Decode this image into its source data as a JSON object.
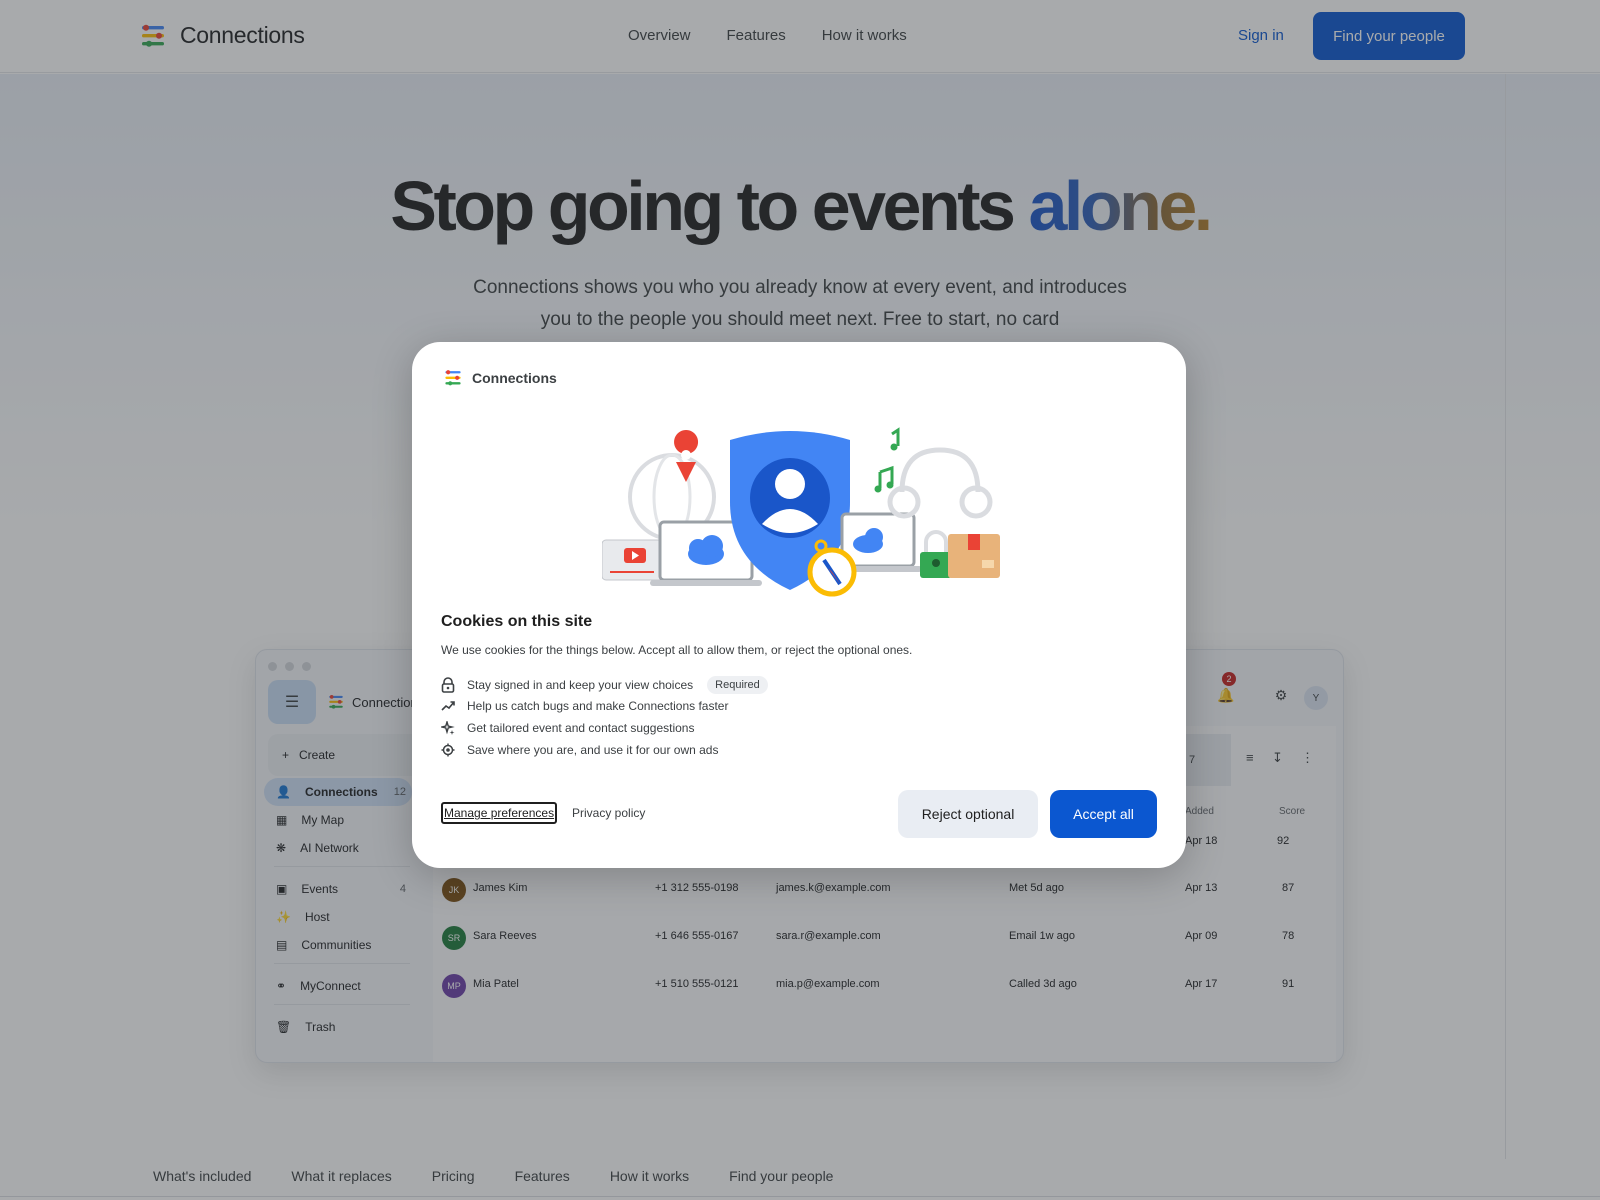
{
  "nav": {
    "brand": "Connections",
    "links": [
      "Overview",
      "Features",
      "How it works"
    ],
    "signin": "Sign in",
    "cta": "Find your people"
  },
  "hero": {
    "title_main": "Stop going to events ",
    "title_accent": "alone.",
    "subtitle": "Connections shows you who you already know at every event, and introduces you to the people you should meet next. Free to start, no card"
  },
  "app": {
    "brand": "Connection",
    "create": "Create",
    "sidebar": [
      {
        "label": "Connections",
        "count": "12",
        "icon": "person-icon"
      },
      {
        "label": "My Map",
        "count": "",
        "icon": "map-icon"
      },
      {
        "label": "AI Network",
        "count": "",
        "icon": "network-icon"
      },
      {
        "label": "Events",
        "count": "4",
        "icon": "calendar-icon"
      },
      {
        "label": "Host",
        "count": "",
        "icon": "party-icon"
      },
      {
        "label": "Communities",
        "count": "",
        "icon": "community-icon"
      },
      {
        "label": "MyConnect",
        "count": "",
        "icon": "link-icon"
      },
      {
        "label": "Trash",
        "count": "",
        "icon": "trash-icon"
      }
    ],
    "notifications": "2",
    "avatar": "Y",
    "filter_pill": "ll 7",
    "columns": {
      "added": "Added",
      "score": "Score"
    },
    "partial_row": {
      "added": "Apr 18",
      "score": "92"
    },
    "rows": [
      {
        "initials": "JK",
        "name": "James Kim",
        "phone": "+1 312 555-0198",
        "email": "james.k@example.com",
        "last": "Met 5d ago",
        "added": "Apr 13",
        "score": "87",
        "color": "#7a4e12"
      },
      {
        "initials": "SR",
        "name": "Sara Reeves",
        "phone": "+1 646 555-0167",
        "email": "sara.r@example.com",
        "last": "Email 1w ago",
        "added": "Apr 09",
        "score": "78",
        "color": "#1e7a3c"
      },
      {
        "initials": "MP",
        "name": "Mia Patel",
        "phone": "+1 510 555-0121",
        "email": "mia.p@example.com",
        "last": "Called 3d ago",
        "added": "Apr 17",
        "score": "91",
        "color": "#6b3fa8"
      }
    ]
  },
  "modal": {
    "brand": "Connections",
    "title": "Cookies on this site",
    "description": "We use cookies for the things below. Accept all to allow them, or reject the optional ones.",
    "purposes": [
      {
        "text": "Stay signed in and keep your view choices",
        "badge": "Required",
        "icon": "lock-icon"
      },
      {
        "text": "Help us catch bugs and make Connections faster",
        "icon": "trend-icon"
      },
      {
        "text": "Get tailored event and contact suggestions",
        "icon": "sparkle-icon"
      },
      {
        "text": "Save where you are, and use it for our own ads",
        "icon": "location-target-icon"
      }
    ],
    "manage": "Manage preferences",
    "privacy": "Privacy policy",
    "reject": "Reject optional",
    "accept": "Accept all"
  },
  "bottom_tabs": [
    "What's included",
    "What it replaces",
    "Pricing",
    "Features",
    "How it works",
    "Find your people"
  ],
  "colors": {
    "primary": "#0b57d0",
    "scrim": "rgba(48,52,58,0.42)",
    "accent_gradient": [
      "#1a56c9",
      "#b07d2a"
    ]
  }
}
